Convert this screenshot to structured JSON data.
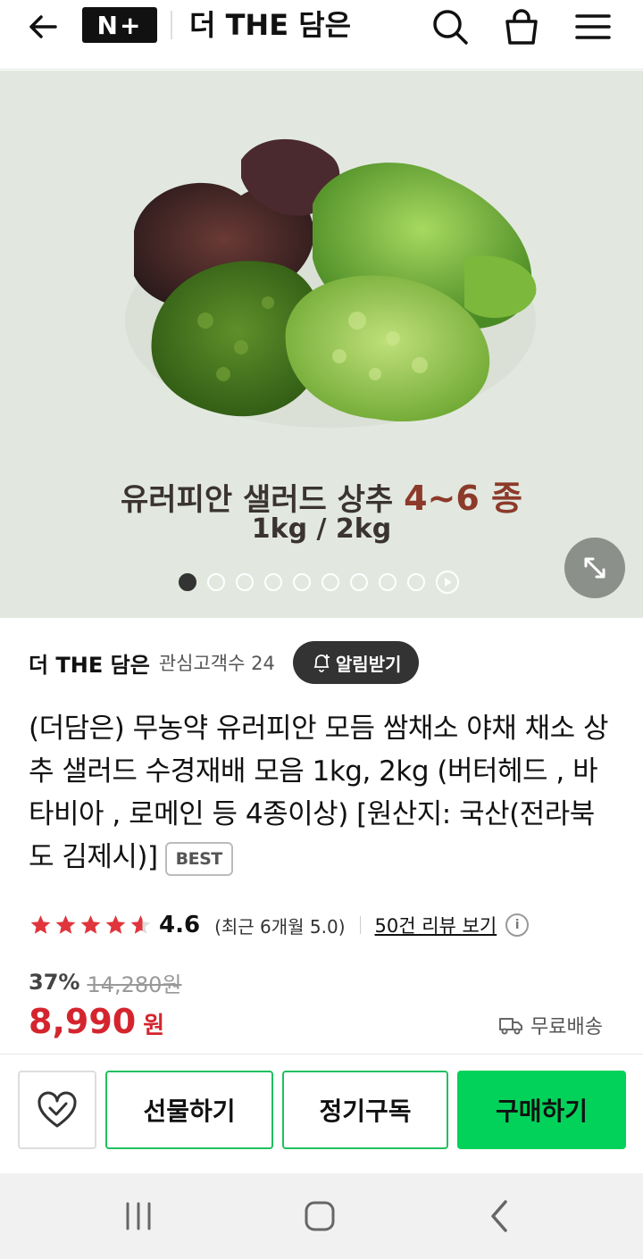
{
  "header": {
    "logo_text": "N+",
    "store_title": "더 THE 담은",
    "icons": [
      "back-arrow-icon",
      "search-icon",
      "cart-icon",
      "menu-icon"
    ]
  },
  "hero": {
    "overlay_line1": "유러피안 샐러드 상추",
    "overlay_line1_accent": "4~6 종",
    "overlay_line2": "1kg / 2kg",
    "slide_count": 9,
    "active_slide": 1,
    "has_video": true
  },
  "store": {
    "name": "더 THE 담은",
    "follower_text": "관심고객수 24",
    "alarm_label": "알림받기"
  },
  "product": {
    "title": "(더담은) 무농약 유러피안 모듬 쌈채소 야채 채소 상추 샐러드 수경재배 모음 1kg, 2kg (버터헤드 , 바타비아 , 로메인 등 4종이상) [원산지: 국산(전라북도 김제시)]",
    "badge": "BEST"
  },
  "rating": {
    "score": "4.6",
    "stars_value": 4.6,
    "recent_text": "(최근 6개월 5.0)",
    "review_link": "50건 리뷰 보기"
  },
  "price": {
    "discount": "37%",
    "original": "14,280원",
    "sale": "8,990",
    "currency": "원",
    "shipping": "무료배송"
  },
  "actions": {
    "gift": "선물하기",
    "subscribe": "정기구독",
    "buy": "구매하기"
  },
  "colors": {
    "price_red": "#d4252f",
    "buy_green": "#03d25a",
    "outline_green": "#20c060",
    "star_red": "#e0353d"
  }
}
